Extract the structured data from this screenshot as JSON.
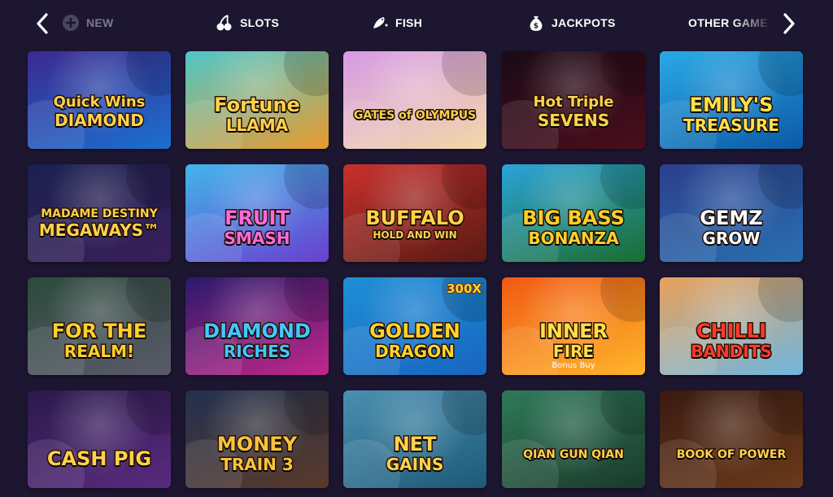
{
  "nav": {
    "categories": [
      {
        "label": "NEW",
        "icon": "plus-circle-icon",
        "active": false
      },
      {
        "label": "SLOTS",
        "icon": "cherries-icon",
        "active": true
      },
      {
        "label": "FISH",
        "icon": "fish-icon",
        "active": true
      },
      {
        "label": "JACKPOTS",
        "icon": "money-bag-icon",
        "active": true
      },
      {
        "label": "OTHER GAMES",
        "icon": "dice-icon",
        "active": true
      }
    ]
  },
  "games": [
    {
      "title": "Quick Wins",
      "subtitle": "DIAMOND",
      "color1": "#3b2a8e",
      "color2": "#1b6fd1",
      "text": "#ffd24a"
    },
    {
      "title": "Fortune",
      "subtitle": "LLAMA",
      "color1": "#4fc7c9",
      "color2": "#e89b2f",
      "text": "#ffd24a"
    },
    {
      "title": "GATES of OLYMPUS",
      "subtitle": "",
      "color1": "#d69be6",
      "color2": "#f3d8a8",
      "text": "#ffd24a"
    },
    {
      "title": "Hot Triple",
      "subtitle": "SEVENS",
      "color1": "#1a0b16",
      "color2": "#4b0d1d",
      "text": "#ffd24a"
    },
    {
      "title": "EMILY'S",
      "subtitle": "TREASURE",
      "color1": "#2aa9e6",
      "color2": "#0c5aa6",
      "text": "#ffe14a"
    },
    {
      "title": "MADAME DESTINY",
      "subtitle": "MEGAWAYS™",
      "color1": "#1a2150",
      "color2": "#3a1f5a",
      "text": "#ffd24a"
    },
    {
      "title": "FRUIT",
      "subtitle": "SMASH",
      "color1": "#41b6ea",
      "color2": "#6a3fd0",
      "text": "#ff6ad7"
    },
    {
      "title": "BUFFALO",
      "subtitle": "HOLD AND WIN",
      "color1": "#c9302c",
      "color2": "#5a1a14",
      "text": "#ffd24a"
    },
    {
      "title": "BIG BASS",
      "subtitle": "BONANZA",
      "color1": "#2aa4d9",
      "color2": "#1c6d2f",
      "text": "#ffcf2a"
    },
    {
      "title": "GEMZ",
      "subtitle": "GROW",
      "color1": "#2b3f8e",
      "color2": "#2a6fb0",
      "text": "#ffffff"
    },
    {
      "title": "FOR THE",
      "subtitle": "REALM!",
      "color1": "#2c4a3c",
      "color2": "#5a5a6a",
      "text": "#ffcf2a"
    },
    {
      "title": "DIAMOND",
      "subtitle": "RICHES",
      "color1": "#2a1a6a",
      "color2": "#c2278c",
      "text": "#42c8ff"
    },
    {
      "title": "GOLDEN",
      "subtitle": "DRAGON",
      "color1": "#1f8fd6",
      "color2": "#1766c0",
      "text": "#ffd42a",
      "badge": "300X"
    },
    {
      "title": "INNER",
      "subtitle": "FIRE",
      "note": "Bonus Buy",
      "color1": "#f05a14",
      "color2": "#ffb52a",
      "text": "#ffe04a"
    },
    {
      "title": "CHILLI",
      "subtitle": "BANDITS",
      "color1": "#e9a15a",
      "color2": "#6fb7e0",
      "text": "#ff3a2a"
    },
    {
      "title": "CASH PIG",
      "subtitle": "",
      "color1": "#2a1a4a",
      "color2": "#5a2a80",
      "text": "#ffd24a"
    },
    {
      "title": "MONEY",
      "subtitle": "TRAIN 3",
      "color1": "#22314f",
      "color2": "#5a3a2a",
      "text": "#f6c43a"
    },
    {
      "title": "NET",
      "subtitle": "GAINS",
      "color1": "#4a8fb0",
      "color2": "#1d5a78",
      "text": "#ffd24a"
    },
    {
      "title": "QIAN GUN QIAN",
      "subtitle": "",
      "color1": "#2e7a5a",
      "color2": "#1b3a2a",
      "text": "#ffd24a"
    },
    {
      "title": "BOOK OF POWER",
      "subtitle": "",
      "color1": "#3a1a12",
      "color2": "#6a3a1a",
      "text": "#ffd24a"
    }
  ],
  "colors": {
    "background": "#1d1630",
    "nav_active": "#ffffff",
    "nav_inactive": "#7d7890"
  }
}
